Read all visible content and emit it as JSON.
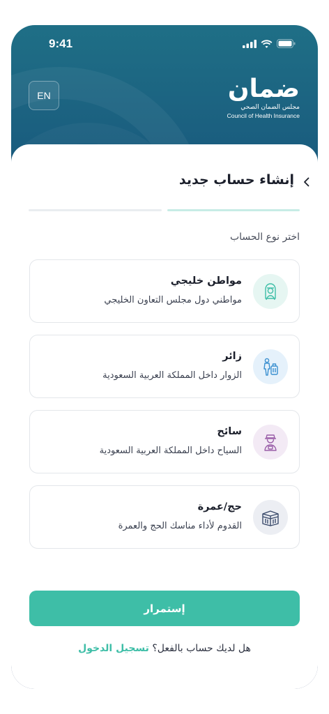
{
  "status_bar": {
    "time": "9:41"
  },
  "header": {
    "language_button": "EN",
    "logo": {
      "arabic_name": "ضمان",
      "arabic_subtitle": "مجلس الضمان الصحي",
      "english_subtitle": "Council of Health Insurance"
    }
  },
  "page": {
    "title": "إنشاء حساب جديد",
    "progress": {
      "total_steps": 2,
      "current_step": 1
    },
    "section_label": "اختر نوع الحساب"
  },
  "options": [
    {
      "title": "مواطن خليجي",
      "description": "مواطني دول مجلس التعاون الخليجي",
      "icon": "gulf-citizen-icon",
      "icon_color": "#3ebea7",
      "icon_bg": "#e6f6f2"
    },
    {
      "title": "زائر",
      "description": "الزوار داخل المملكة العربية السعودية",
      "icon": "visitor-luggage-icon",
      "icon_color": "#3a8fd0",
      "icon_bg": "#e5f1fb"
    },
    {
      "title": "سائح",
      "description": "السياح داخل المملكة العربية السعودية",
      "icon": "tourist-icon",
      "icon_color": "#9a5ea8",
      "icon_bg": "#f3eaf5"
    },
    {
      "title": "حج/عمرة",
      "description": "القدوم لأداء مناسك الحج والعمرة",
      "icon": "kaaba-icon",
      "icon_color": "#3a4a6b",
      "icon_bg": "#eceef3"
    }
  ],
  "continue_button": "إستمرار",
  "login_prompt": {
    "question": "هل لديك حساب بالفعل؟",
    "link": "تسجيل الدخول"
  },
  "colors": {
    "accent": "#3ebea7",
    "background_top": "#1f6f86",
    "background_bottom": "#172c5f"
  }
}
